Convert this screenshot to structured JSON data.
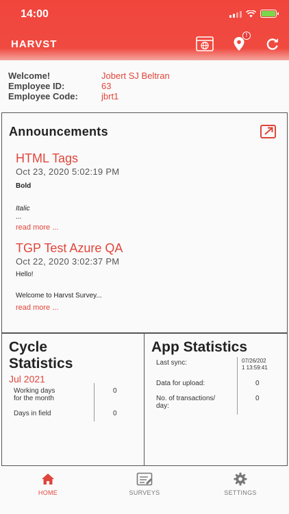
{
  "status_bar": {
    "time": "14:00"
  },
  "header": {
    "app_title": "HARVST",
    "notification_badge": "!"
  },
  "welcome": {
    "welcome_label": "Welcome!",
    "welcome_value": "Jobert SJ Beltran",
    "employee_id_label": "Employee ID:",
    "employee_id_value": "63",
    "employee_code_label": "Employee Code:",
    "employee_code_value": "jbrt1"
  },
  "announcements": {
    "title": "Announcements",
    "items": [
      {
        "title": "HTML Tags",
        "date": "Oct 23, 2020  5:02:19 PM",
        "line1": "Bold",
        "line2": "Italic",
        "line3": "...",
        "read_more": "read more ..."
      },
      {
        "title": "TGP Test Azure QA",
        "date": "Oct 22, 2020  3:02:37 PM",
        "line1": "Hello!",
        "line2": "Welcome to Harvst Survey...",
        "read_more": "read more ..."
      }
    ]
  },
  "cycle_stats": {
    "title_line1": "Cycle",
    "title_line2": "Statistics",
    "month": "Jul 2021",
    "working_days_label_1": "Working days",
    "working_days_label_2": "for the month",
    "working_days_value": "0",
    "days_in_field_label": "Days in field",
    "days_in_field_value": "0"
  },
  "app_stats": {
    "title": "App Statistics",
    "last_sync_label": "Last sync:",
    "last_sync_value_1": "07/26/202",
    "last_sync_value_2": "1 13:59:41",
    "upload_label": "Data for upload:",
    "upload_value": "0",
    "transactions_label_1": "No. of transactions/",
    "transactions_label_2": "day:",
    "transactions_value": "0"
  },
  "nav": {
    "home": "HOME",
    "surveys": "SURVEYS",
    "settings": "SETTINGS"
  },
  "colors": {
    "accent": "#e0453a",
    "header": "#f0453c"
  }
}
